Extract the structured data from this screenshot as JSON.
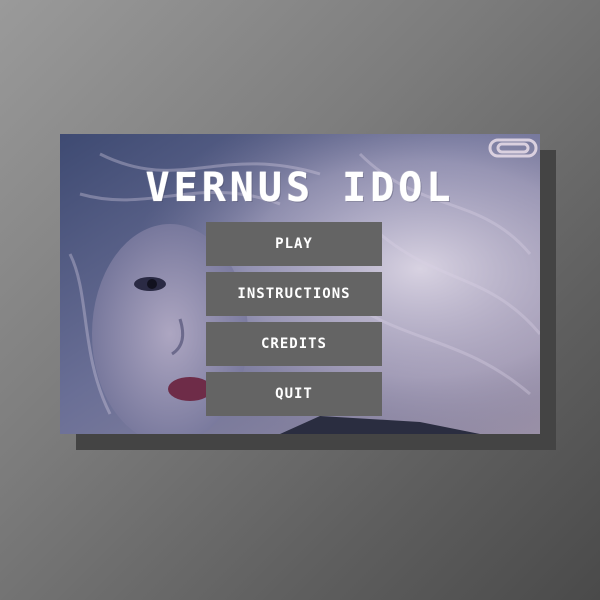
{
  "title": "VERNUS IDOL",
  "menu": {
    "play_label": "PLAY",
    "instructions_label": "INSTRUCTIONS",
    "credits_label": "CREDITS",
    "quit_label": "QUIT"
  },
  "colors": {
    "page_background": "#7a7a7a",
    "shadow": "#444444",
    "button_background": "#646464",
    "button_text": "#ffffff",
    "title_text": "#ffffff"
  },
  "icons": {
    "background_art": "portrait-artwork",
    "corner_decor": "paperclip-icon"
  }
}
